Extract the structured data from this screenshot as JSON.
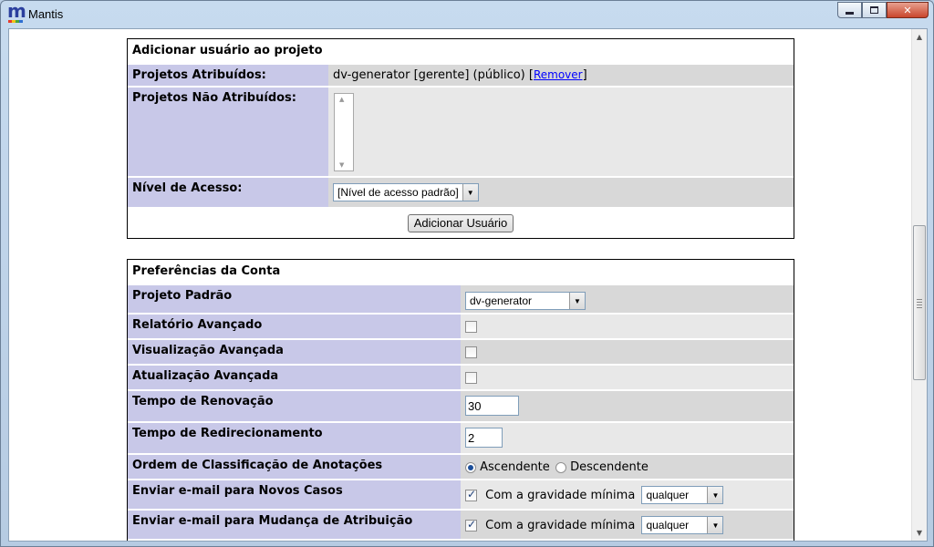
{
  "window": {
    "title": "Mantis"
  },
  "add_user_panel": {
    "heading": "Adicionar usuário ao projeto",
    "assigned_label": "Projetos Atribuídos:",
    "assigned_value": "dv-generator [gerente] (público)",
    "remove_link": "Remover",
    "unassigned_label": "Projetos Não Atribuídos:",
    "access_label": "Nível de Acesso:",
    "access_select": "[Nível de acesso padrão]",
    "add_button": "Adicionar Usuário"
  },
  "prefs": {
    "heading": "Preferências da Conta",
    "default_project_label": "Projeto Padrão",
    "default_project_value": "dv-generator",
    "adv_report_label": "Relatório Avançado",
    "adv_view_label": "Visualização Avançada",
    "adv_update_label": "Atualização Avançada",
    "refresh_label": "Tempo de Renovação",
    "refresh_value": "30",
    "redirect_label": "Tempo de Redirecionamento",
    "redirect_value": "2",
    "order_label": "Ordem de Classificação de Anotações",
    "asc_label": "Ascendente",
    "desc_label": "Descendente",
    "email_new_label": "Enviar e-mail para Novos Casos",
    "email_assign_label": "Enviar e-mail para Mudança de Atribuição",
    "severity_text": "Com a gravidade mínima",
    "severity_value": "qualquer"
  }
}
